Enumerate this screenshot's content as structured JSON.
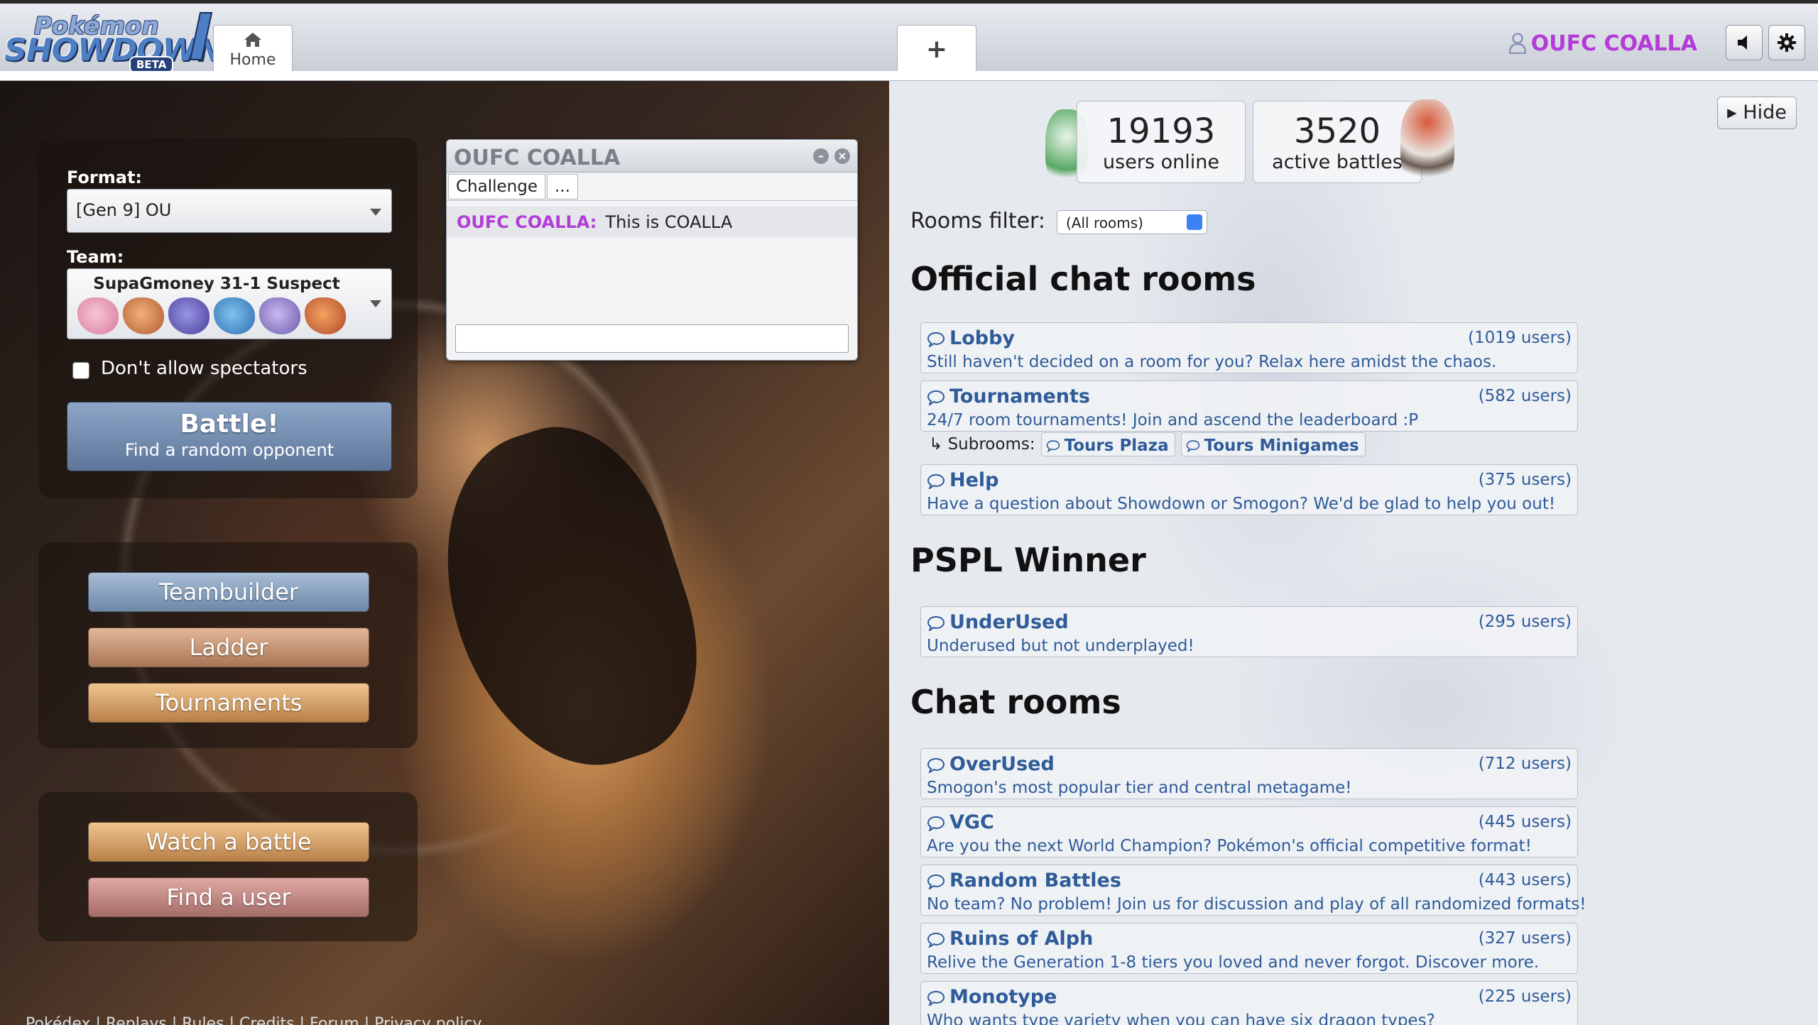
{
  "header": {
    "logo": {
      "line1": "Pokémon",
      "line2": "SHOWDOWN",
      "badge": "BETA"
    },
    "home_tab": "Home",
    "new_tab": "+",
    "username": "OUFC COALLA",
    "username_color": "#b33bd8"
  },
  "menu": {
    "format_label": "Format:",
    "format_value": "[Gen 9] OU",
    "team_label": "Team:",
    "team_name": "SupaGmoney 31-1 Suspect",
    "team_icons": [
      "clefable-icon",
      "meowscarada-icon",
      "dragapult-icon",
      "gyarados-icon",
      "kartana-icon",
      "talonflame-icon"
    ],
    "no_spectators": "Don't allow spectators",
    "battle_title": "Battle!",
    "battle_sub": "Find a random opponent",
    "teambuilder": "Teambuilder",
    "ladder": "Ladder",
    "tournaments": "Tournaments",
    "watch_battle": "Watch a battle",
    "find_user": "Find a user",
    "footer": "Pokédex | Replays | Rules | Credits | Forum | Privacy policy"
  },
  "pm": {
    "title": "OUFC COALLA",
    "tab_challenge": "Challenge",
    "tab_more": "...",
    "message_user": "OUFC COALLA:",
    "message_text": "This is COALLA"
  },
  "rooms": {
    "hide": "Hide",
    "users_online": "19193",
    "users_online_label": "users online",
    "active_battles": "3520",
    "active_battles_label": "active battles",
    "filter_label": "Rooms filter:",
    "filter_value": "(All rooms)",
    "official_heading": "Official chat rooms",
    "official": [
      {
        "name": "Lobby",
        "count": "(1019 users)",
        "desc": "Still haven't decided on a room for you? Relax here amidst the chaos."
      },
      {
        "name": "Tournaments",
        "count": "(582 users)",
        "desc": "24/7 room tournaments! Join and ascend the leaderboard :P"
      },
      {
        "name": "Help",
        "count": "(375 users)",
        "desc": "Have a question about Showdown or Smogon? We'd be glad to help you out!"
      }
    ],
    "subrooms_label": "↳ Subrooms:",
    "subrooms": [
      "Tours Plaza",
      "Tours Minigames"
    ],
    "pspl_heading": "PSPL Winner",
    "pspl": [
      {
        "name": "UnderUsed",
        "count": "(295 users)",
        "desc": "Underused but not underplayed!"
      }
    ],
    "chat_heading": "Chat rooms",
    "chat": [
      {
        "name": "OverUsed",
        "count": "(712 users)",
        "desc": "Smogon's most popular tier and central metagame!"
      },
      {
        "name": "VGC",
        "count": "(445 users)",
        "desc": "Are you the next World Champion? Pokémon's official competitive format!"
      },
      {
        "name": "Random Battles",
        "count": "(443 users)",
        "desc": "No team? No problem! Join us for discussion and play of all randomized formats!"
      },
      {
        "name": "Ruins of Alph",
        "count": "(327 users)",
        "desc": "Relive the Generation 1-8 tiers you loved and never forgot. Discover more."
      },
      {
        "name": "Monotype",
        "count": "(225 users)",
        "desc": "Who wants type variety when you can have six dragon types?"
      }
    ]
  }
}
